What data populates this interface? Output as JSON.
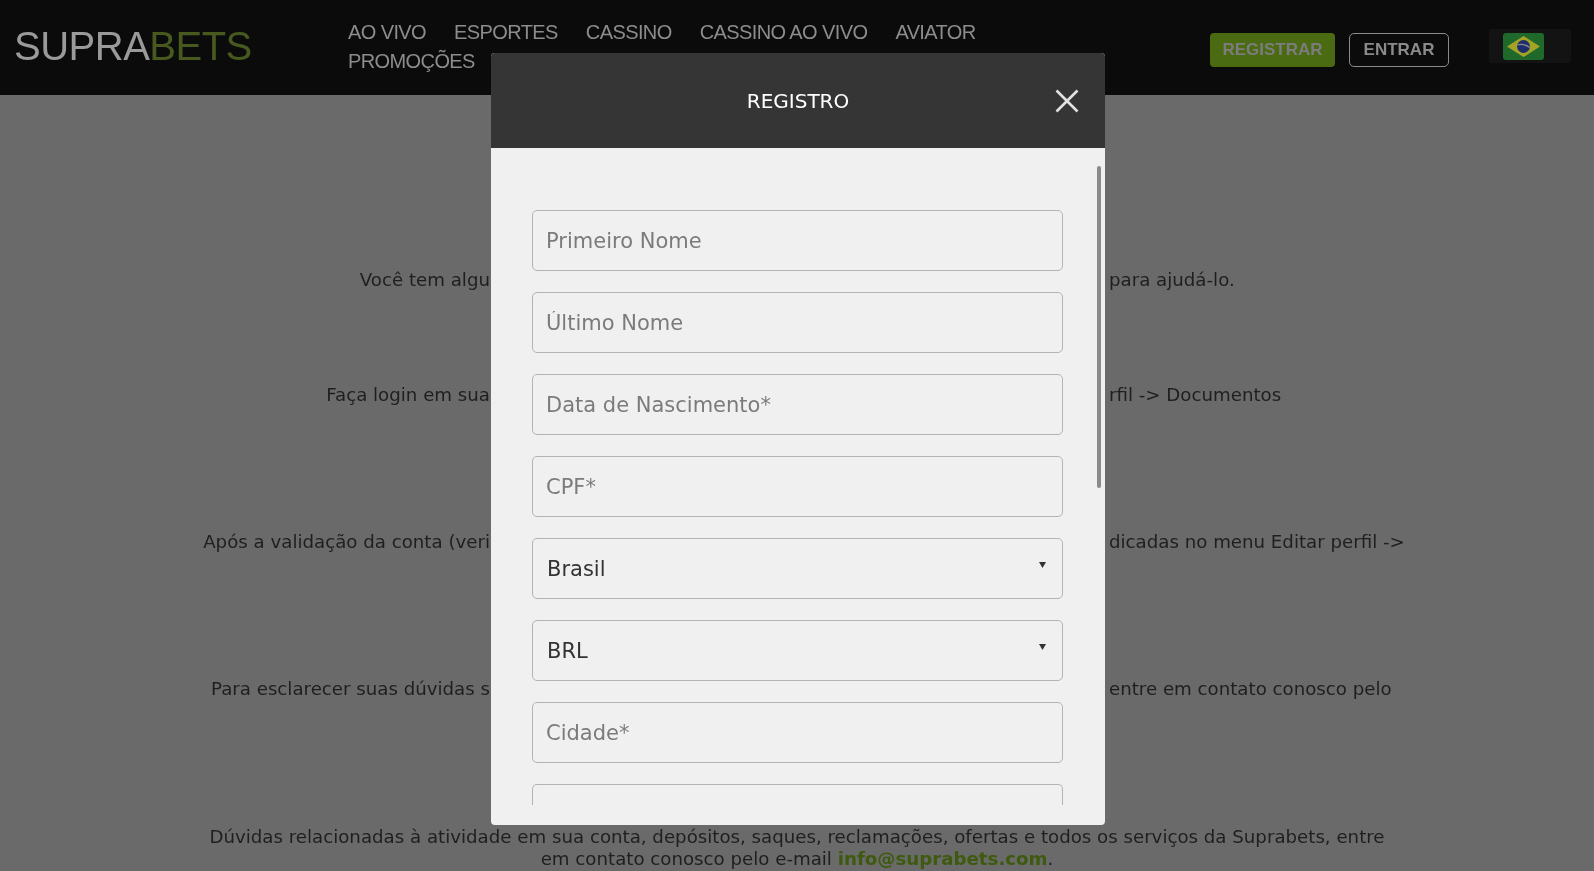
{
  "header": {
    "logo": {
      "primary": "SUPRA",
      "accent": "BETS"
    },
    "nav": [
      "AO VIVO",
      "ESPORTES",
      "CASSINO",
      "CASSINO AO VIVO",
      "AVIATOR",
      "PROMOÇÕES"
    ],
    "buttons": [
      {
        "label": "REGISTRAR",
        "kind": "primary"
      },
      {
        "label": "ENTRAR",
        "kind": "outline"
      }
    ]
  },
  "content": {
    "lines": [
      {
        "left": "Você tem algu",
        "right": "para ajudá-lo."
      },
      {
        "left": "Faça login em sua",
        "right": "rfil -> Documentos"
      },
      {
        "left": "Após a validação da conta (veri",
        "right": "dicadas no menu Editar perfil ->"
      },
      {
        "left": "Para esclarecer suas dúvidas s",
        "right": "entre em contato conosco pelo"
      }
    ],
    "footer": {
      "text": "Dúvidas relacionadas à atividade em sua conta, depósitos, saques, reclamações, ofertas e todos os serviços da Suprabets, entre em contato conosco pelo e-mail ",
      "link": "info@suprabets.com",
      "after": "."
    }
  },
  "modal": {
    "title": "REGISTRO",
    "fields": [
      {
        "kind": "text",
        "placeholder": "Primeiro Nome"
      },
      {
        "kind": "text",
        "placeholder": "Último Nome"
      },
      {
        "kind": "text",
        "placeholder": "Data de Nascimento*"
      },
      {
        "kind": "text",
        "placeholder": "CPF*"
      },
      {
        "kind": "select",
        "value": "Brasil"
      },
      {
        "kind": "select",
        "value": "BRL"
      },
      {
        "kind": "text",
        "placeholder": "Cidade*"
      },
      {
        "kind": "text"
      }
    ]
  }
}
